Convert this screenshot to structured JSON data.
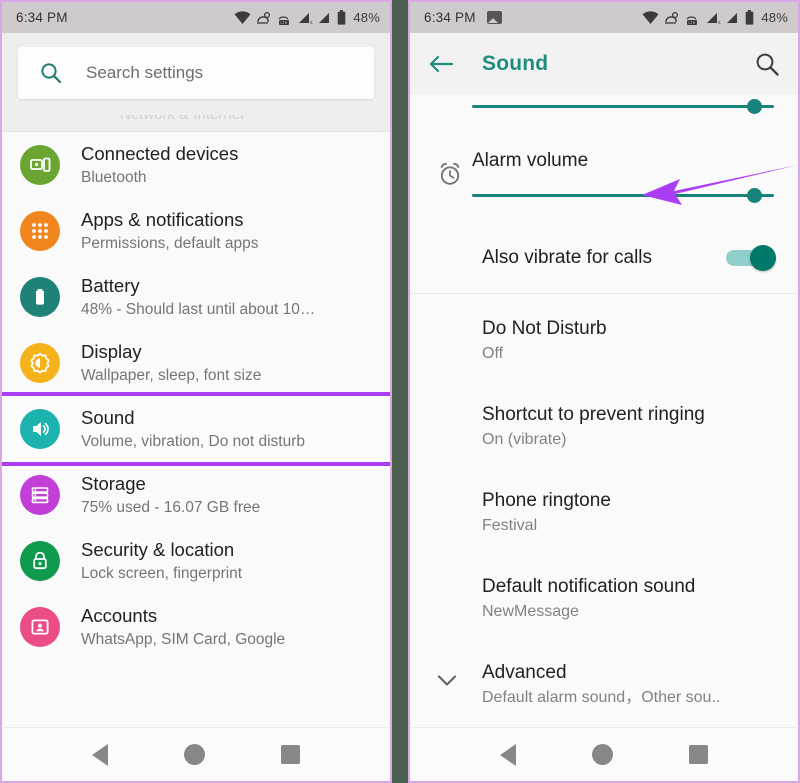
{
  "left_screen": {
    "statusbar": {
      "time": "6:34 PM",
      "battery_percent": "48%",
      "icons": [
        "wifi-icon",
        "cast-icon",
        "lte-signal-icon",
        "signal-no-sim-icon",
        "signal-icon",
        "battery-icon"
      ]
    },
    "search": {
      "placeholder": "Search settings",
      "icon": "search-icon"
    },
    "partial_row_text": "Network & Internet",
    "items": [
      {
        "title": "Connected devices",
        "subtitle": "Bluetooth",
        "icon": "connected-devices-icon",
        "color": "#6aa532",
        "highlighted": false
      },
      {
        "title": "Apps & notifications",
        "subtitle": "Permissions, default apps",
        "icon": "apps-grid-icon",
        "color": "#f2861e",
        "highlighted": false
      },
      {
        "title": "Battery",
        "subtitle": "48% - Should last until about 10…",
        "icon": "battery-icon",
        "color": "#1e8278",
        "highlighted": false
      },
      {
        "title": "Display",
        "subtitle": "Wallpaper, sleep, font size",
        "icon": "brightness-icon",
        "color": "#f6b21b",
        "highlighted": false
      },
      {
        "title": "Sound",
        "subtitle": "Volume, vibration, Do not disturb",
        "icon": "volume-speaker-icon",
        "color": "#1cb3ae",
        "highlighted": true
      },
      {
        "title": "Storage",
        "subtitle": "75% used - 16.07 GB free",
        "icon": "storage-server-icon",
        "color": "#c13fd6",
        "highlighted": false
      },
      {
        "title": "Security & location",
        "subtitle": "Lock screen, fingerprint",
        "icon": "lock-icon",
        "color": "#0f9a4e",
        "highlighted": false
      },
      {
        "title": "Accounts",
        "subtitle": "WhatsApp, SIM Card, Google",
        "icon": "account-card-icon",
        "color": "#ec4d86",
        "highlighted": false
      }
    ],
    "navbar": {
      "back": "back-triangle-icon",
      "home": "home-circle-icon",
      "recents": "recents-square-icon"
    }
  },
  "right_screen": {
    "statusbar": {
      "time": "6:34 PM",
      "photo_icon": "photo-icon",
      "battery_percent": "48%"
    },
    "appbar": {
      "back_icon": "back-arrow-icon",
      "title": "Sound",
      "search_icon": "search-icon",
      "title_color": "#1f8d7e"
    },
    "sliders": [
      {
        "label": "",
        "icon": "",
        "value_percent": 91,
        "partial": true
      },
      {
        "label": "Alarm volume",
        "icon": "alarm-clock-icon",
        "value_percent": 91,
        "partial": false
      }
    ],
    "vibrate_row": {
      "label": "Also vibrate for calls",
      "toggle_state": "on",
      "toggle_color": "#00796b"
    },
    "preferences": [
      {
        "title": "Do Not Disturb",
        "subtitle": "Off",
        "chevron": false,
        "annotated": true
      },
      {
        "title": "Shortcut to prevent ringing",
        "subtitle": "On (vibrate)",
        "chevron": false,
        "annotated": false
      },
      {
        "title": "Phone ringtone",
        "subtitle": "Festival",
        "chevron": false,
        "annotated": false
      },
      {
        "title": "Default notification sound",
        "subtitle": "NewMessage",
        "chevron": false,
        "annotated": false
      },
      {
        "title": "Advanced",
        "subtitle": "Default alarm sound，Other sou..",
        "chevron": true,
        "annotated": false
      }
    ],
    "navbar": {
      "back": "back-triangle-icon",
      "home": "home-circle-icon",
      "recents": "recents-square-icon"
    }
  },
  "annotations": {
    "highlight_color": "#ab3ef5",
    "arrow_color": "#ab3ef5",
    "arrow_target": "Do Not Disturb"
  }
}
